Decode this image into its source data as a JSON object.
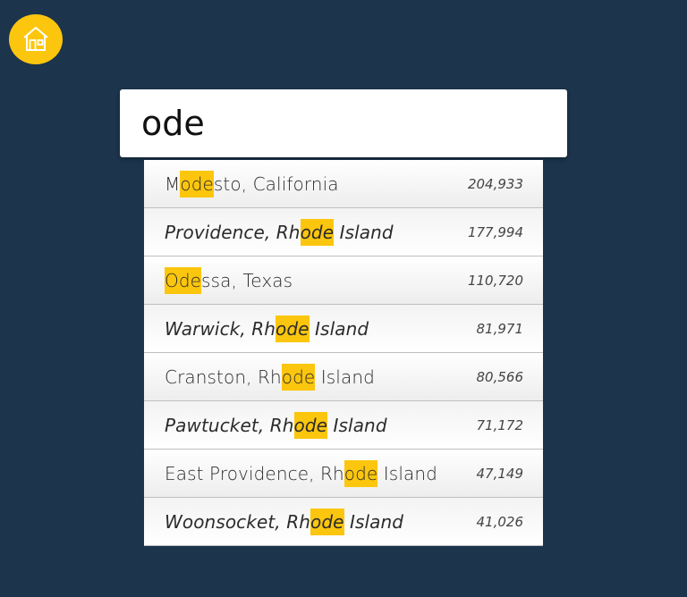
{
  "colors": {
    "background": "#1c344c",
    "accent": "#fcc60e",
    "row_text": "#2b2b2b"
  },
  "home_button": {
    "icon": "home-icon"
  },
  "search": {
    "value": "ode"
  },
  "results": [
    {
      "pre": "M",
      "match": "ode",
      "post": "sto, California",
      "population": "204,933",
      "italic": false
    },
    {
      "pre": "Providence, Rh",
      "match": "ode",
      "post": " Island",
      "population": "177,994",
      "italic": true
    },
    {
      "pre": "",
      "match": "Ode",
      "post": "ssa, Texas",
      "population": "110,720",
      "italic": false
    },
    {
      "pre": "Warwick, Rh",
      "match": "ode",
      "post": " Island",
      "population": "81,971",
      "italic": true
    },
    {
      "pre": "Cranston, Rh",
      "match": "ode",
      "post": " Island",
      "population": "80,566",
      "italic": false
    },
    {
      "pre": "Pawtucket, Rh",
      "match": "ode",
      "post": " Island",
      "population": "71,172",
      "italic": true
    },
    {
      "pre": "East Providence, Rh",
      "match": "ode",
      "post": " Island",
      "population": "47,149",
      "italic": false
    },
    {
      "pre": "Woonsocket, Rh",
      "match": "ode",
      "post": " Island",
      "population": "41,026",
      "italic": true
    }
  ]
}
